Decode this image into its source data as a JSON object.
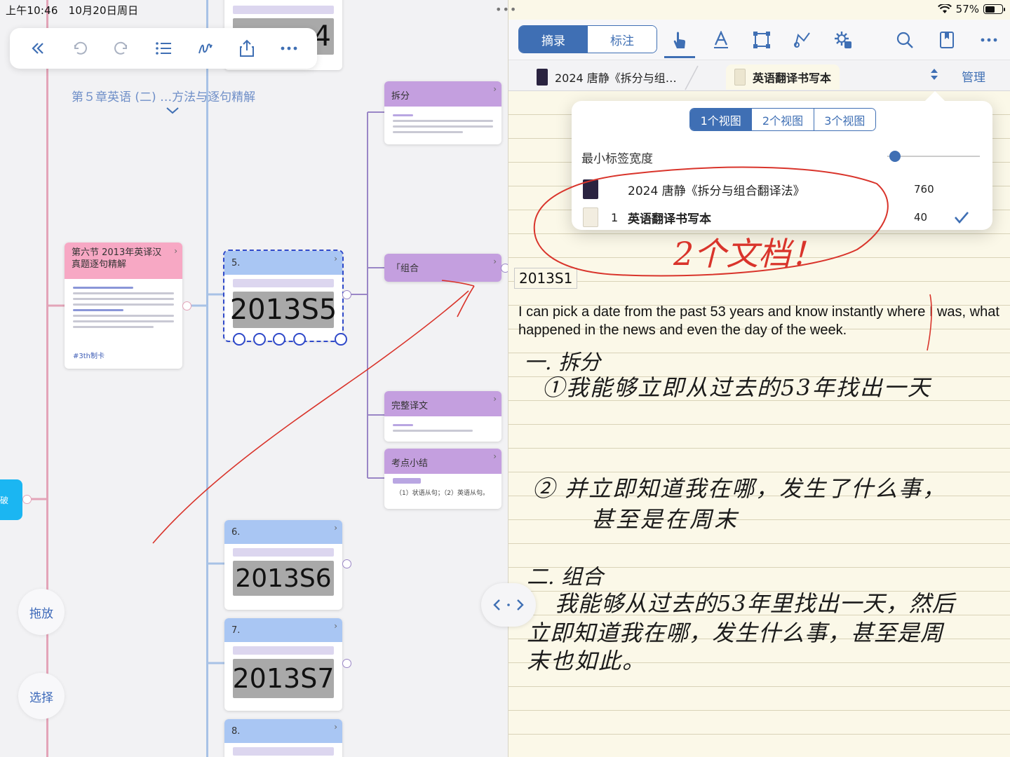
{
  "status_bar": {
    "time": "上午10:46",
    "date": "10月20日周日",
    "battery": "57%",
    "battery_level": 0.57
  },
  "mindmap": {
    "chapter_title": "第５章英语 (二) …方法与逐句精解",
    "section_card": {
      "title": "第六节 2013年英译汉真题逐句精解",
      "tag": "#3th制卡"
    },
    "selected_card": {
      "number": "5.",
      "code": "2013S5"
    },
    "branches": [
      {
        "title": "拆分"
      },
      {
        "title": "「组合"
      },
      {
        "title": "完整译文"
      },
      {
        "title": "考点小结",
        "body": "（1）状语从句；（2）英语从句。"
      }
    ],
    "cards": [
      {
        "number": "6.",
        "code": "2013S6"
      },
      {
        "number": "7.",
        "code": "2013S7"
      },
      {
        "number": "8.",
        "code": ""
      }
    ],
    "top_card_code": "4",
    "side_node_label": "破",
    "buttons": {
      "drag": "拖放",
      "select": "选择"
    }
  },
  "right_pane": {
    "segmented": {
      "excerpt": "摘录",
      "annotate": "标注"
    },
    "tabs": [
      {
        "label": "2024 唐静《拆分与组…"
      },
      {
        "label": "英语翻译书写本"
      }
    ],
    "manage": "管理",
    "note_code": "2013S1",
    "note_text": "I can pick a date from the past 53 years and know instantly where I was, what happened in the news and even the day of the week.",
    "handwriting": {
      "h1": "一. 拆分",
      "h1a": "①我能够立即从过去的53年找出一天",
      "h2": "② 并立即知道我在哪，发生了什么事，",
      "h2b": "甚至是在周末",
      "h3": "二. 组合",
      "h3a": "我能够从过去的53年里找出一天，然后",
      "h3b": "立即知道我在哪，发生什么事，甚至是周",
      "h3c": "末也如此。",
      "annotation": "2个文档！"
    }
  },
  "popover": {
    "views": [
      "1个视图",
      "2个视图",
      "3个视图"
    ],
    "min_tab_width_label": "最小标签宽度",
    "docs": [
      {
        "num": "",
        "name": "2024 唐静《拆分与组合翻译法》",
        "count": "760"
      },
      {
        "num": "1",
        "name": "英语翻译书写本",
        "count": "40"
      }
    ]
  },
  "colors": {
    "accent": "#3f6fb4",
    "purple_card": "#c49fdf",
    "blue_card": "#a9c6f3",
    "pink_card": "#f7a8c4",
    "ink_red": "#d9342b"
  }
}
